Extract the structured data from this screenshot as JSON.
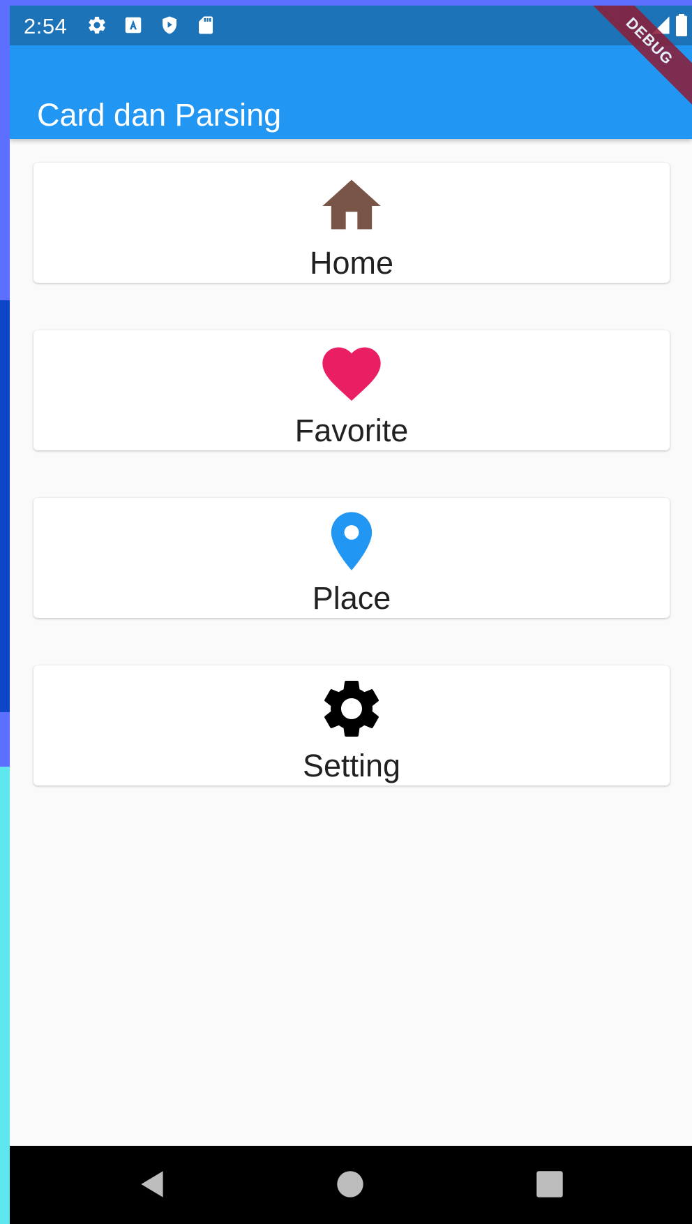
{
  "status_bar": {
    "time": "2:54",
    "icons": [
      "gear-icon",
      "a-icon",
      "shield-play-icon",
      "sd-card-icon",
      "signal-icon",
      "battery-icon"
    ]
  },
  "app_bar": {
    "title": "Card dan Parsing",
    "color": "#2196F3",
    "debug_label": "DEBUG"
  },
  "cards": [
    {
      "label": "Home",
      "icon": "home-icon",
      "color": "#795548"
    },
    {
      "label": "Favorite",
      "icon": "heart-icon",
      "color": "#E91E63"
    },
    {
      "label": "Place",
      "icon": "place-icon",
      "color": "#2196F3"
    },
    {
      "label": "Setting",
      "icon": "settings-icon",
      "color": "#000000"
    }
  ],
  "nav_bar": {
    "icons": [
      "back-icon",
      "home-circle-icon",
      "recents-icon"
    ]
  }
}
